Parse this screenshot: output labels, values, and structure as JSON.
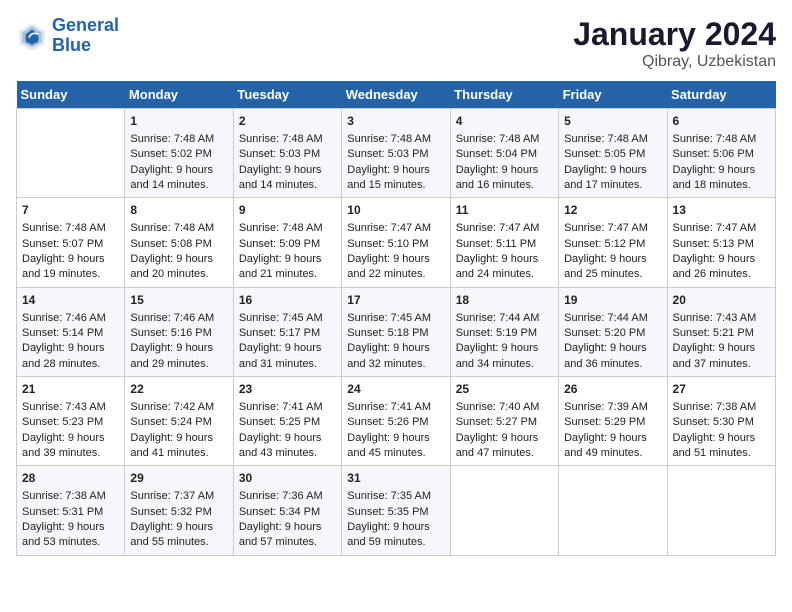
{
  "header": {
    "logo_line1": "General",
    "logo_line2": "Blue",
    "title": "January 2024",
    "subtitle": "Qibray, Uzbekistan"
  },
  "columns": [
    "Sunday",
    "Monday",
    "Tuesday",
    "Wednesday",
    "Thursday",
    "Friday",
    "Saturday"
  ],
  "weeks": [
    [
      {
        "day": "",
        "empty": true
      },
      {
        "day": "1",
        "sunrise": "Sunrise: 7:48 AM",
        "sunset": "Sunset: 5:02 PM",
        "daylight": "Daylight: 9 hours and 14 minutes."
      },
      {
        "day": "2",
        "sunrise": "Sunrise: 7:48 AM",
        "sunset": "Sunset: 5:03 PM",
        "daylight": "Daylight: 9 hours and 14 minutes."
      },
      {
        "day": "3",
        "sunrise": "Sunrise: 7:48 AM",
        "sunset": "Sunset: 5:03 PM",
        "daylight": "Daylight: 9 hours and 15 minutes."
      },
      {
        "day": "4",
        "sunrise": "Sunrise: 7:48 AM",
        "sunset": "Sunset: 5:04 PM",
        "daylight": "Daylight: 9 hours and 16 minutes."
      },
      {
        "day": "5",
        "sunrise": "Sunrise: 7:48 AM",
        "sunset": "Sunset: 5:05 PM",
        "daylight": "Daylight: 9 hours and 17 minutes."
      },
      {
        "day": "6",
        "sunrise": "Sunrise: 7:48 AM",
        "sunset": "Sunset: 5:06 PM",
        "daylight": "Daylight: 9 hours and 18 minutes."
      }
    ],
    [
      {
        "day": "7",
        "sunrise": "Sunrise: 7:48 AM",
        "sunset": "Sunset: 5:07 PM",
        "daylight": "Daylight: 9 hours and 19 minutes."
      },
      {
        "day": "8",
        "sunrise": "Sunrise: 7:48 AM",
        "sunset": "Sunset: 5:08 PM",
        "daylight": "Daylight: 9 hours and 20 minutes."
      },
      {
        "day": "9",
        "sunrise": "Sunrise: 7:48 AM",
        "sunset": "Sunset: 5:09 PM",
        "daylight": "Daylight: 9 hours and 21 minutes."
      },
      {
        "day": "10",
        "sunrise": "Sunrise: 7:47 AM",
        "sunset": "Sunset: 5:10 PM",
        "daylight": "Daylight: 9 hours and 22 minutes."
      },
      {
        "day": "11",
        "sunrise": "Sunrise: 7:47 AM",
        "sunset": "Sunset: 5:11 PM",
        "daylight": "Daylight: 9 hours and 24 minutes."
      },
      {
        "day": "12",
        "sunrise": "Sunrise: 7:47 AM",
        "sunset": "Sunset: 5:12 PM",
        "daylight": "Daylight: 9 hours and 25 minutes."
      },
      {
        "day": "13",
        "sunrise": "Sunrise: 7:47 AM",
        "sunset": "Sunset: 5:13 PM",
        "daylight": "Daylight: 9 hours and 26 minutes."
      }
    ],
    [
      {
        "day": "14",
        "sunrise": "Sunrise: 7:46 AM",
        "sunset": "Sunset: 5:14 PM",
        "daylight": "Daylight: 9 hours and 28 minutes."
      },
      {
        "day": "15",
        "sunrise": "Sunrise: 7:46 AM",
        "sunset": "Sunset: 5:16 PM",
        "daylight": "Daylight: 9 hours and 29 minutes."
      },
      {
        "day": "16",
        "sunrise": "Sunrise: 7:45 AM",
        "sunset": "Sunset: 5:17 PM",
        "daylight": "Daylight: 9 hours and 31 minutes."
      },
      {
        "day": "17",
        "sunrise": "Sunrise: 7:45 AM",
        "sunset": "Sunset: 5:18 PM",
        "daylight": "Daylight: 9 hours and 32 minutes."
      },
      {
        "day": "18",
        "sunrise": "Sunrise: 7:44 AM",
        "sunset": "Sunset: 5:19 PM",
        "daylight": "Daylight: 9 hours and 34 minutes."
      },
      {
        "day": "19",
        "sunrise": "Sunrise: 7:44 AM",
        "sunset": "Sunset: 5:20 PM",
        "daylight": "Daylight: 9 hours and 36 minutes."
      },
      {
        "day": "20",
        "sunrise": "Sunrise: 7:43 AM",
        "sunset": "Sunset: 5:21 PM",
        "daylight": "Daylight: 9 hours and 37 minutes."
      }
    ],
    [
      {
        "day": "21",
        "sunrise": "Sunrise: 7:43 AM",
        "sunset": "Sunset: 5:23 PM",
        "daylight": "Daylight: 9 hours and 39 minutes."
      },
      {
        "day": "22",
        "sunrise": "Sunrise: 7:42 AM",
        "sunset": "Sunset: 5:24 PM",
        "daylight": "Daylight: 9 hours and 41 minutes."
      },
      {
        "day": "23",
        "sunrise": "Sunrise: 7:41 AM",
        "sunset": "Sunset: 5:25 PM",
        "daylight": "Daylight: 9 hours and 43 minutes."
      },
      {
        "day": "24",
        "sunrise": "Sunrise: 7:41 AM",
        "sunset": "Sunset: 5:26 PM",
        "daylight": "Daylight: 9 hours and 45 minutes."
      },
      {
        "day": "25",
        "sunrise": "Sunrise: 7:40 AM",
        "sunset": "Sunset: 5:27 PM",
        "daylight": "Daylight: 9 hours and 47 minutes."
      },
      {
        "day": "26",
        "sunrise": "Sunrise: 7:39 AM",
        "sunset": "Sunset: 5:29 PM",
        "daylight": "Daylight: 9 hours and 49 minutes."
      },
      {
        "day": "27",
        "sunrise": "Sunrise: 7:38 AM",
        "sunset": "Sunset: 5:30 PM",
        "daylight": "Daylight: 9 hours and 51 minutes."
      }
    ],
    [
      {
        "day": "28",
        "sunrise": "Sunrise: 7:38 AM",
        "sunset": "Sunset: 5:31 PM",
        "daylight": "Daylight: 9 hours and 53 minutes."
      },
      {
        "day": "29",
        "sunrise": "Sunrise: 7:37 AM",
        "sunset": "Sunset: 5:32 PM",
        "daylight": "Daylight: 9 hours and 55 minutes."
      },
      {
        "day": "30",
        "sunrise": "Sunrise: 7:36 AM",
        "sunset": "Sunset: 5:34 PM",
        "daylight": "Daylight: 9 hours and 57 minutes."
      },
      {
        "day": "31",
        "sunrise": "Sunrise: 7:35 AM",
        "sunset": "Sunset: 5:35 PM",
        "daylight": "Daylight: 9 hours and 59 minutes."
      },
      {
        "day": "",
        "empty": true
      },
      {
        "day": "",
        "empty": true
      },
      {
        "day": "",
        "empty": true
      }
    ]
  ]
}
